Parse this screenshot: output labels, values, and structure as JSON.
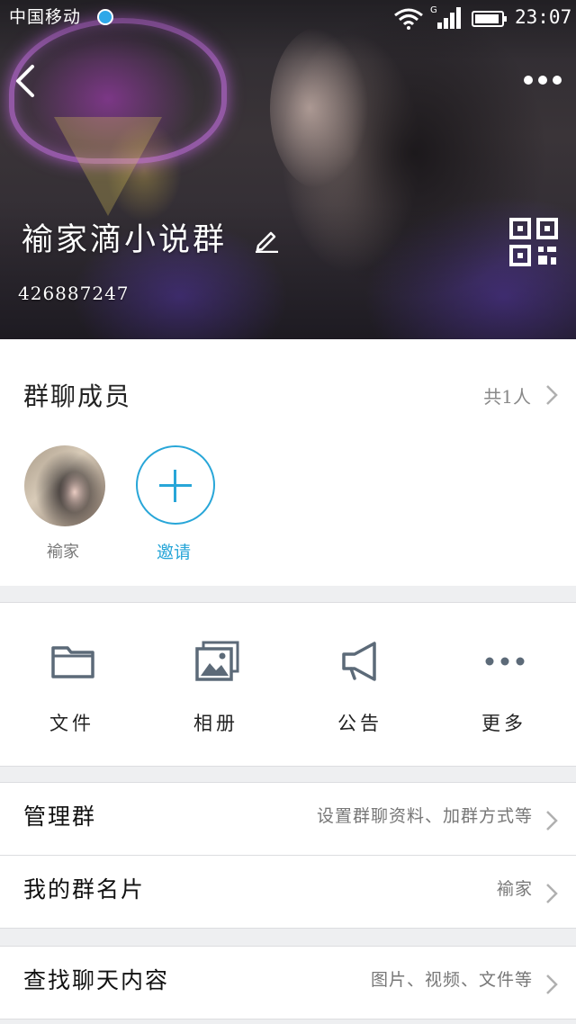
{
  "status_bar": {
    "carrier": "中国移动",
    "time": "23:07",
    "signal_label": "G"
  },
  "header": {
    "group_name": "褕家滴小说群",
    "group_id": "426887247"
  },
  "members": {
    "title": "群聊成员",
    "count": "共1人",
    "list": [
      {
        "name": "褕家"
      }
    ],
    "invite_label": "邀请"
  },
  "functions": [
    {
      "label": "文件",
      "icon": "folder-icon"
    },
    {
      "label": "相册",
      "icon": "photo-album-icon"
    },
    {
      "label": "公告",
      "icon": "megaphone-icon"
    },
    {
      "label": "更多",
      "icon": "more-dots-icon"
    }
  ],
  "rows": {
    "manage": {
      "title": "管理群",
      "value": "设置群聊资料、加群方式等"
    },
    "my_card": {
      "title": "我的群名片",
      "value": "褕家"
    },
    "search": {
      "title": "查找聊天内容",
      "value": "图片、视频、文件等"
    }
  },
  "colors": {
    "accent": "#28a6d8",
    "background": "#eeeff1",
    "card": "#ffffff"
  }
}
